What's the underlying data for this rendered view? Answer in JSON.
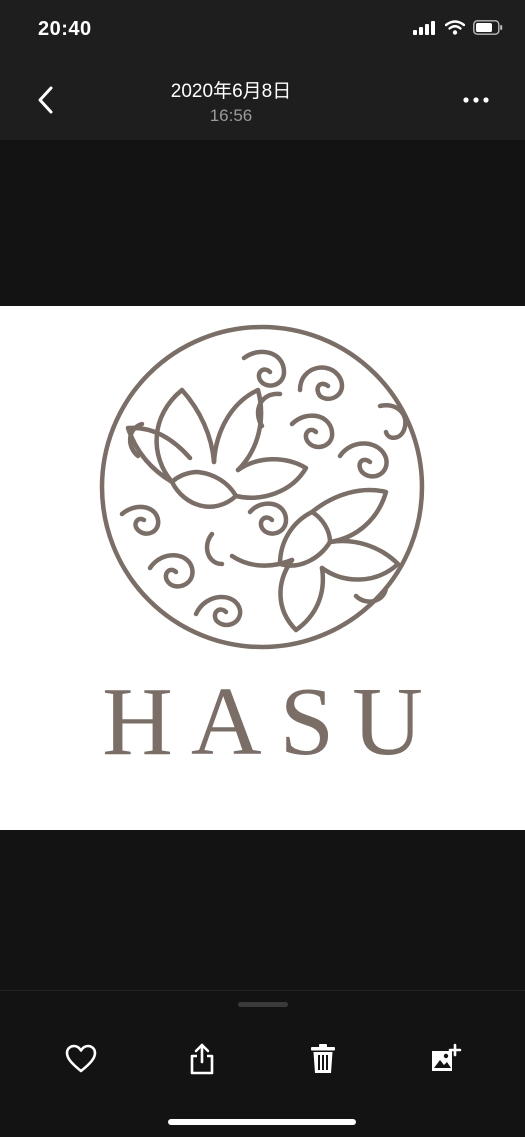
{
  "status": {
    "time": "20:40"
  },
  "nav": {
    "title": "2020年6月8日",
    "subtitle": "16:56"
  },
  "photo": {
    "logo_text": "HASU"
  },
  "colors": {
    "logo_brown": "#7b6e66",
    "background": "#131313",
    "bar": "#1e1e1e"
  },
  "toolbar": {
    "icons": [
      "heart-icon",
      "share-icon",
      "trash-icon",
      "add-to-album-icon"
    ]
  },
  "icons": {
    "back": "chevron-left-icon",
    "more": "more-icon"
  }
}
